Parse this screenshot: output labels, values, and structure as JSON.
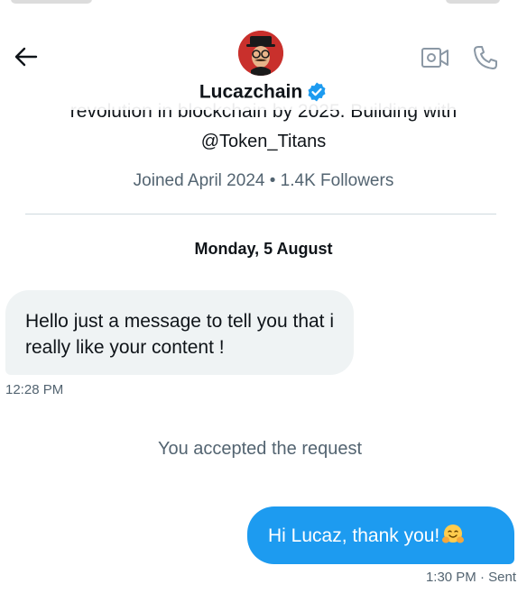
{
  "header": {
    "name": "Lucazchain",
    "verified": true
  },
  "profile": {
    "bio_tail": "revolution in blockchain by 2025. Building with",
    "handle_line": "@Token_Titans",
    "joined_followers": "Joined April 2024 • 1.4K Followers"
  },
  "conversation": {
    "date": "Monday, 5 August",
    "incoming": {
      "text": "Hello just a message to tell you that i really like your content !",
      "time": "12:28 PM"
    },
    "system_note": "You accepted the request",
    "outgoing": {
      "text": "Hi Lucaz, thank you!",
      "emoji": "hugging-face",
      "time_status": "1:30 PM · Sent"
    }
  },
  "colors": {
    "accent": "#1d9bf0",
    "muted": "#536471",
    "bubble_in": "#eff3f4"
  }
}
